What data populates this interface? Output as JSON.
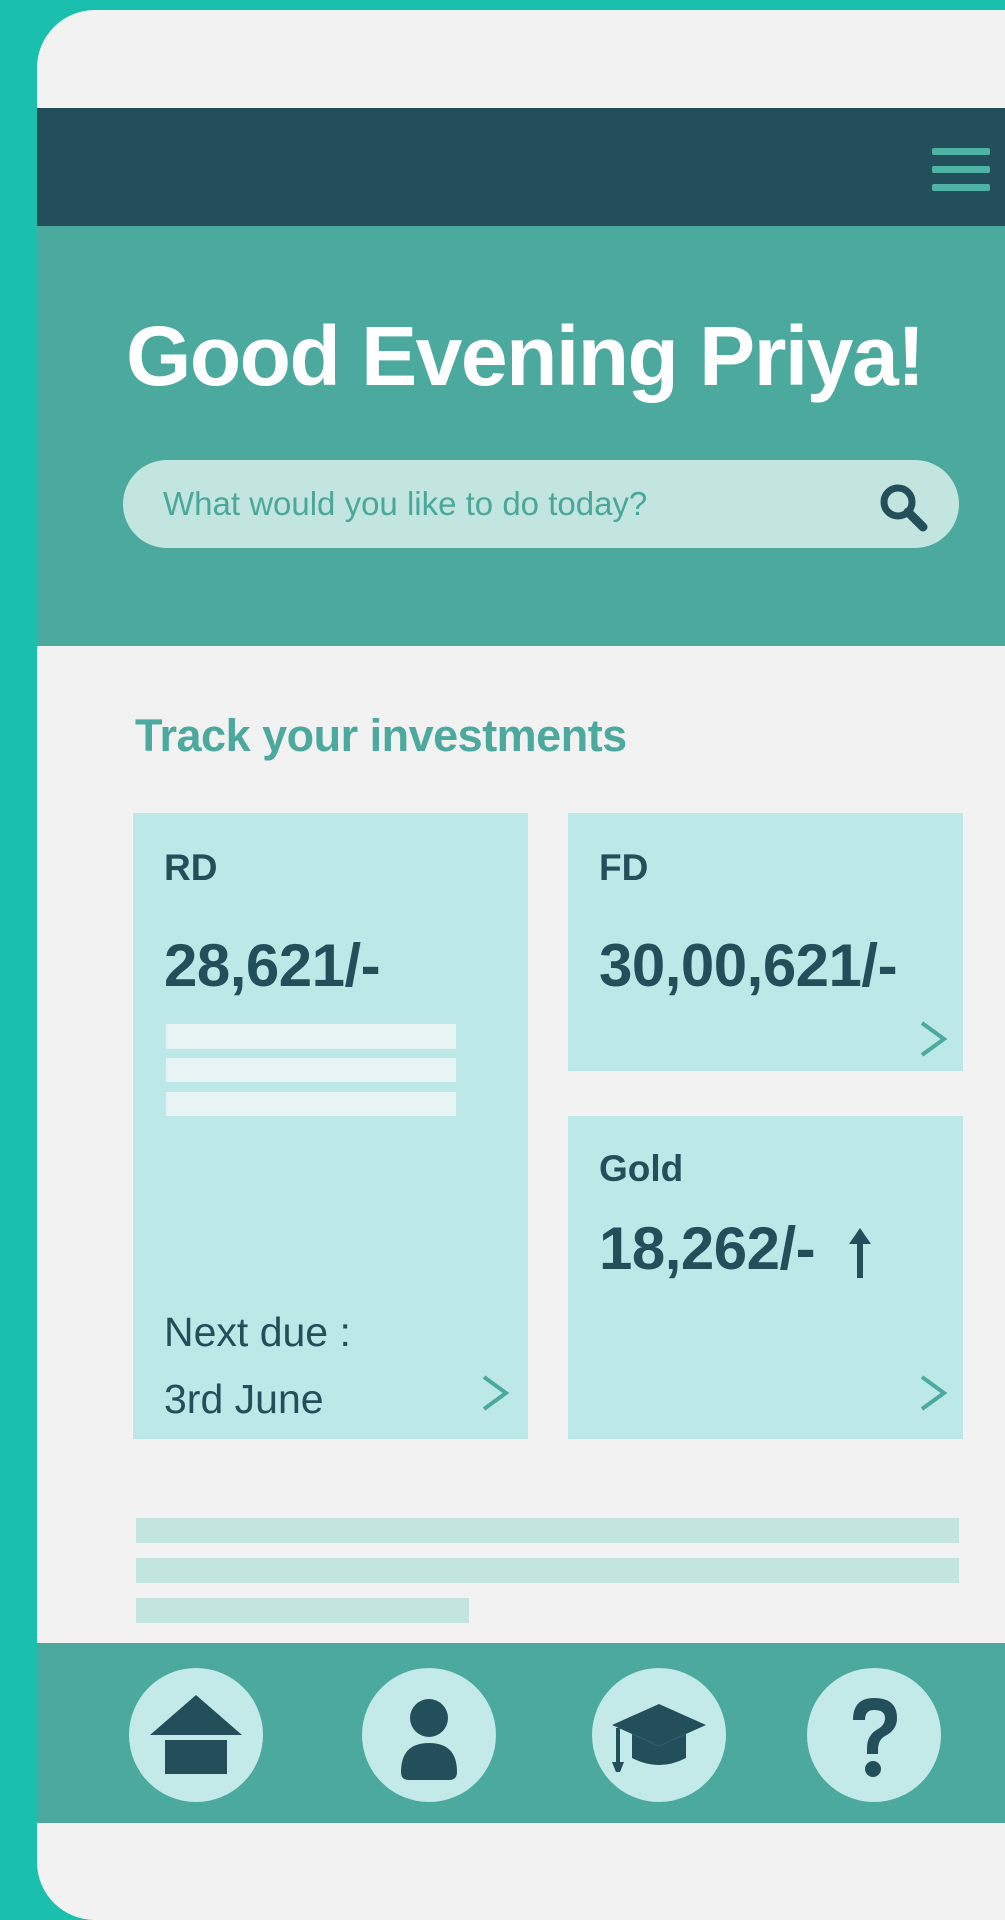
{
  "header": {
    "menu_icon": "hamburger-menu-icon"
  },
  "hero": {
    "greeting": "Good Evening Priya!",
    "search": {
      "placeholder": "What would you like to do today?",
      "icon": "search-icon"
    }
  },
  "investments": {
    "title": "Track your investments",
    "cards": [
      {
        "label": "RD",
        "amount": "28,621/-",
        "next_due_label": "Next due :",
        "next_due_date": "3rd June"
      },
      {
        "label": "FD",
        "amount": "30,00,621/-"
      },
      {
        "label": "Gold",
        "amount": "18,262/-",
        "trend": "up-arrow-icon"
      }
    ]
  },
  "bottom_nav": {
    "items": [
      {
        "name": "home",
        "icon": "home-icon"
      },
      {
        "name": "profile",
        "icon": "user-icon"
      },
      {
        "name": "learn",
        "icon": "graduation-cap-icon"
      },
      {
        "name": "help",
        "icon": "question-mark-icon"
      }
    ]
  },
  "colors": {
    "outer": "#1bbfad",
    "screen": "#f2f2f2",
    "topbar": "#234f5b",
    "hero": "#4ca99d",
    "card": "#bde8e8",
    "text_dark": "#234f5b",
    "accent": "#4ca99d"
  }
}
